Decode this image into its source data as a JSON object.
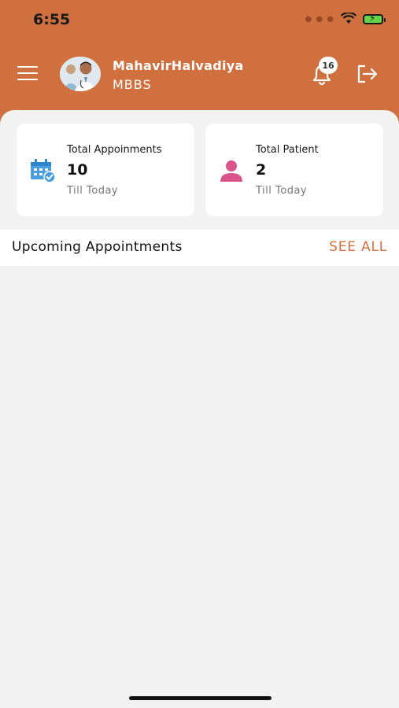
{
  "status_bar": {
    "time": "6:55",
    "icons": [
      "signal-dots-icon",
      "wifi-icon",
      "battery-charging-icon"
    ]
  },
  "header": {
    "background_color": "#d0703f",
    "menu_icon": "hamburger-icon",
    "profile": {
      "name": "MahavirHalvadiya",
      "degree": "MBBS"
    },
    "notifications": {
      "icon": "bell-icon",
      "count": "16"
    },
    "logout_icon": "logout-icon"
  },
  "stats": [
    {
      "icon": "calendar-check-icon",
      "icon_color": "#4a9fe0",
      "title": "Total Appoinments",
      "value": "10",
      "subtitle": "Till Today"
    },
    {
      "icon": "person-icon",
      "icon_color": "#d9548a",
      "title": "Total Patient",
      "value": "2",
      "subtitle": "Till Today"
    }
  ],
  "upcoming": {
    "title": "Upcoming Appointments",
    "see_all_label": "SEE ALL",
    "accent_color": "#d0703f"
  }
}
